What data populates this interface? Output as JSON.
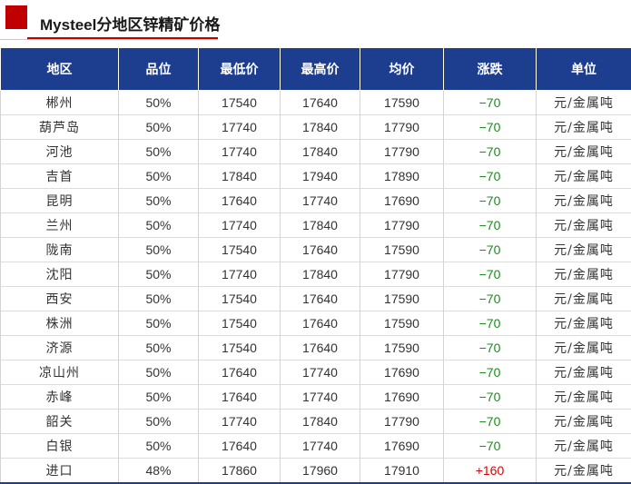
{
  "header": {
    "title": "Mysteel分地区锌精矿价格",
    "accent_color": "#c00000"
  },
  "table": {
    "header_color": "#1d3e8e",
    "down_color": "#1a8c1a",
    "up_color": "#e00000",
    "columns": [
      "地区",
      "品位",
      "最低价",
      "最高价",
      "均价",
      "涨跌",
      "单位"
    ],
    "rows": [
      {
        "region": "郴州",
        "grade": "50%",
        "low": "17540",
        "high": "17640",
        "avg": "17590",
        "change": "−70",
        "unit": "元/金属吨",
        "dir": "down"
      },
      {
        "region": "葫芦岛",
        "grade": "50%",
        "low": "17740",
        "high": "17840",
        "avg": "17790",
        "change": "−70",
        "unit": "元/金属吨",
        "dir": "down"
      },
      {
        "region": "河池",
        "grade": "50%",
        "low": "17740",
        "high": "17840",
        "avg": "17790",
        "change": "−70",
        "unit": "元/金属吨",
        "dir": "down"
      },
      {
        "region": "吉首",
        "grade": "50%",
        "low": "17840",
        "high": "17940",
        "avg": "17890",
        "change": "−70",
        "unit": "元/金属吨",
        "dir": "down"
      },
      {
        "region": "昆明",
        "grade": "50%",
        "low": "17640",
        "high": "17740",
        "avg": "17690",
        "change": "−70",
        "unit": "元/金属吨",
        "dir": "down"
      },
      {
        "region": "兰州",
        "grade": "50%",
        "low": "17740",
        "high": "17840",
        "avg": "17790",
        "change": "−70",
        "unit": "元/金属吨",
        "dir": "down"
      },
      {
        "region": "陇南",
        "grade": "50%",
        "low": "17540",
        "high": "17640",
        "avg": "17590",
        "change": "−70",
        "unit": "元/金属吨",
        "dir": "down"
      },
      {
        "region": "沈阳",
        "grade": "50%",
        "low": "17740",
        "high": "17840",
        "avg": "17790",
        "change": "−70",
        "unit": "元/金属吨",
        "dir": "down"
      },
      {
        "region": "西安",
        "grade": "50%",
        "low": "17540",
        "high": "17640",
        "avg": "17590",
        "change": "−70",
        "unit": "元/金属吨",
        "dir": "down"
      },
      {
        "region": "株洲",
        "grade": "50%",
        "low": "17540",
        "high": "17640",
        "avg": "17590",
        "change": "−70",
        "unit": "元/金属吨",
        "dir": "down"
      },
      {
        "region": "济源",
        "grade": "50%",
        "low": "17540",
        "high": "17640",
        "avg": "17590",
        "change": "−70",
        "unit": "元/金属吨",
        "dir": "down"
      },
      {
        "region": "凉山州",
        "grade": "50%",
        "low": "17640",
        "high": "17740",
        "avg": "17690",
        "change": "−70",
        "unit": "元/金属吨",
        "dir": "down"
      },
      {
        "region": "赤峰",
        "grade": "50%",
        "low": "17640",
        "high": "17740",
        "avg": "17690",
        "change": "−70",
        "unit": "元/金属吨",
        "dir": "down"
      },
      {
        "region": "韶关",
        "grade": "50%",
        "low": "17740",
        "high": "17840",
        "avg": "17790",
        "change": "−70",
        "unit": "元/金属吨",
        "dir": "down"
      },
      {
        "region": "白银",
        "grade": "50%",
        "low": "17640",
        "high": "17740",
        "avg": "17690",
        "change": "−70",
        "unit": "元/金属吨",
        "dir": "down"
      },
      {
        "region": "进口",
        "grade": "48%",
        "low": "17860",
        "high": "17960",
        "avg": "17910",
        "change": "+160",
        "unit": "元/金属吨",
        "dir": "up"
      }
    ]
  }
}
